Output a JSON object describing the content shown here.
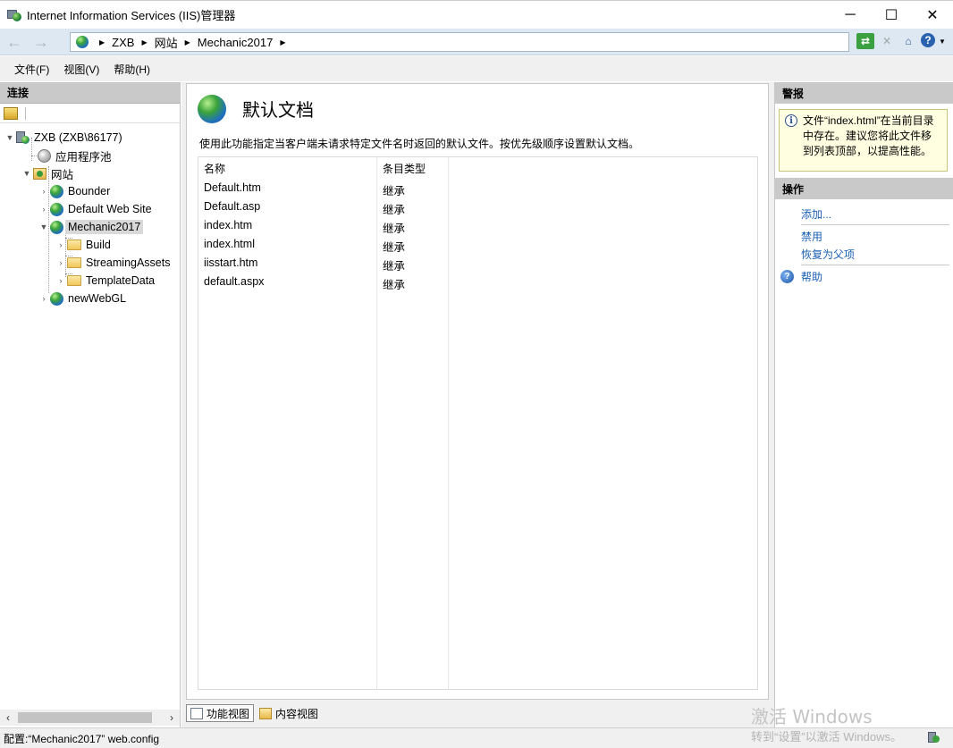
{
  "window": {
    "title": "Internet Information Services (IIS)管理器",
    "controls": {
      "minimize": "─",
      "maximize": "☐",
      "close": "✕"
    }
  },
  "address": {
    "crumbs": [
      "ZXB",
      "网站",
      "Mechanic2017"
    ],
    "back": "←",
    "forward": "→"
  },
  "menu": {
    "items": [
      "文件(F)",
      "视图(V)",
      "帮助(H)"
    ]
  },
  "connections": {
    "header": "连接",
    "tree": {
      "server": "ZXB (ZXB\\86177)",
      "app_pools": "应用程序池",
      "sites": "网站",
      "site_items": [
        "Bounder",
        "Default Web Site",
        "Mechanic2017"
      ],
      "mechanic_children": [
        "Build",
        "StreamingAssets",
        "TemplateData"
      ],
      "last_site": "newWebGL"
    }
  },
  "feature": {
    "title": "默认文档",
    "description": "使用此功能指定当客户端未请求特定文件名时返回的默认文件。按优先级顺序设置默认文档。",
    "columns": {
      "name": "名称",
      "type": "条目类型"
    },
    "rows": [
      {
        "name": "Default.htm",
        "type": "继承"
      },
      {
        "name": "Default.asp",
        "type": "继承"
      },
      {
        "name": "index.htm",
        "type": "继承"
      },
      {
        "name": "index.html",
        "type": "继承"
      },
      {
        "name": "iisstart.htm",
        "type": "继承"
      },
      {
        "name": "default.aspx",
        "type": "继承"
      }
    ]
  },
  "bottom_tabs": {
    "features_view": "功能视图",
    "content_view": "内容视图"
  },
  "alerts": {
    "header": "警报",
    "message": "文件“index.html”在当前目录中存在。建议您将此文件移到列表顶部，以提高性能。"
  },
  "actions": {
    "header": "操作",
    "add": "添加...",
    "disable": "禁用",
    "revert": "恢复为父项",
    "help": "帮助"
  },
  "status": {
    "text": "配置:“Mechanic2017” web.config"
  },
  "watermark": {
    "line1": "激活 Windows",
    "line2": "转到“设置”以激活 Windows。"
  },
  "colors": {
    "address_bar": "#dde8f3",
    "pane_header": "#c9c9c9",
    "link": "#1a5fb4",
    "alert_bg": "#fffee1"
  }
}
